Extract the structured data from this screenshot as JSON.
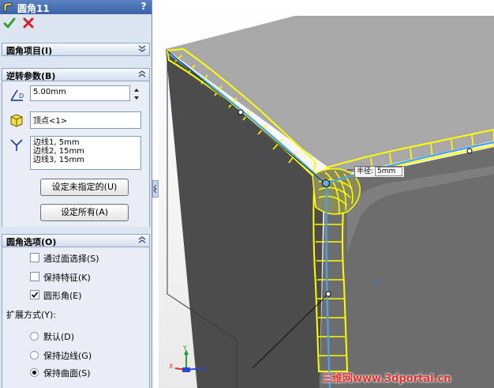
{
  "title": "圆角11",
  "help_label": "?",
  "groups": {
    "fillet_items": {
      "label": "圆角项目(I)"
    },
    "setback": {
      "label": "逆转参数(B)",
      "distance_value": "5.00mm",
      "vertex_value": "顶点<1>",
      "edges": [
        "边线1, 5mm",
        "边线2, 15mm",
        "边线3, 15mm"
      ],
      "set_unassigned_label": "设定未指定的(U)",
      "set_all_label": "设定所有(A)"
    },
    "fillet_options": {
      "label": "圆角选项(O)",
      "select_through_faces": {
        "label": "通过面选择(S)",
        "checked": false
      },
      "keep_features": {
        "label": "保持特征(K)",
        "checked": false
      },
      "round_corners": {
        "label": "圆形角(E)",
        "checked": true
      },
      "overflow_label": "扩展方式(Y):",
      "overflow_options": [
        {
          "label": "默认(D)",
          "selected": false
        },
        {
          "label": "保持边线(G)",
          "selected": false
        },
        {
          "label": "保持曲面(S)",
          "selected": true
        }
      ]
    }
  },
  "viewport": {
    "radius_callout_label": "半径:",
    "radius_callout_value": "5mm",
    "triad": {
      "x": "X",
      "y": "Y",
      "z": "Z"
    },
    "watermark": "三维网www.3dportal.cn"
  },
  "colors": {
    "fillet_preview": "#ffff00",
    "edge_highlight": "#4aa3e8",
    "box_face": "#6d6d6d"
  }
}
